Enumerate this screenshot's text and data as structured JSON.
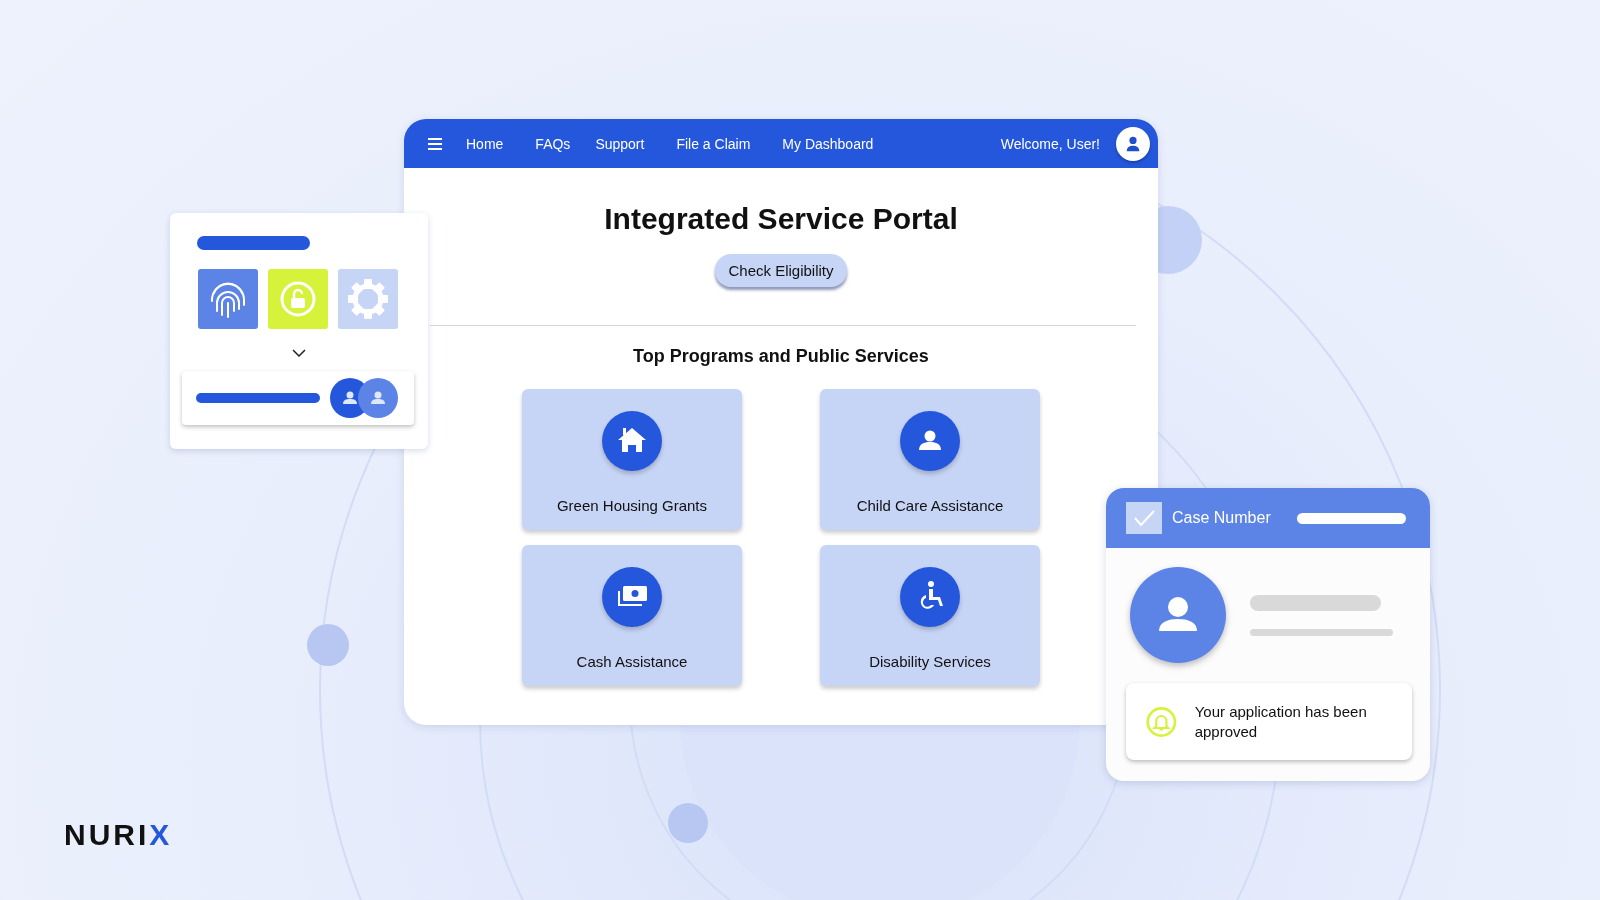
{
  "nav": {
    "items": [
      "Home",
      "FAQs",
      "Support",
      "File a Claim",
      "My Dashboard"
    ],
    "welcome": "Welcome, User!"
  },
  "portal": {
    "title": "Integrated Service Portal",
    "button": "Check Eligibility",
    "section_title": "Top Programs and Public Services",
    "programs": [
      {
        "label": "Green Housing Grants",
        "kind": "house"
      },
      {
        "label": "Child Care Assistance",
        "kind": "person"
      },
      {
        "label": "Cash Assistance",
        "kind": "cash"
      },
      {
        "label": "Disability Services",
        "kind": "wheelchair"
      }
    ]
  },
  "case_card": {
    "title": "Case Number",
    "checked": true,
    "notification": "Your application has been approved"
  },
  "logo": {
    "text": "NURIX"
  }
}
